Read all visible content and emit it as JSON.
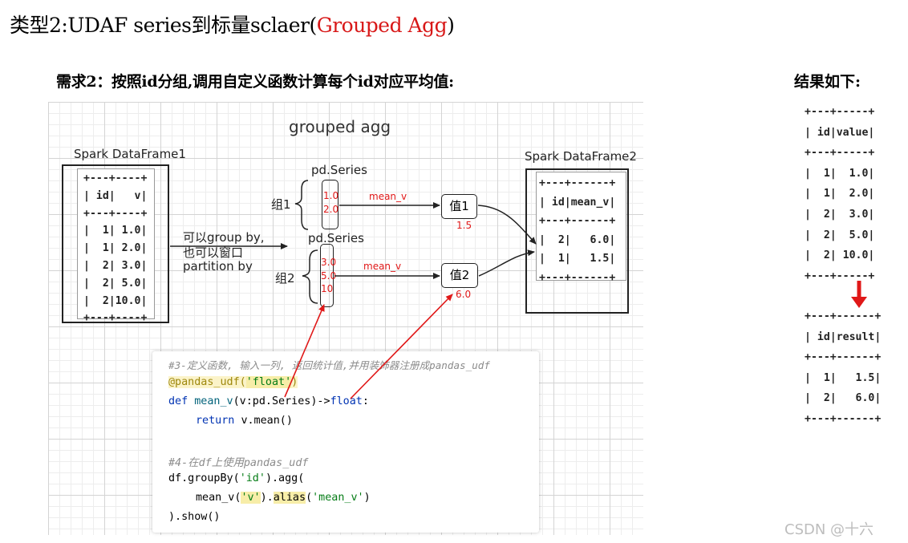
{
  "title": {
    "prefix": "类型2:UDAF series到标量sclaer(",
    "highlight": "Grouped Agg",
    "suffix": ")"
  },
  "requirement": "需求2：按照id分组,调用自定义函数计算每个id对应平均值:",
  "result_title": "结果如下:",
  "diagram": {
    "heading": "grouped agg",
    "df1": {
      "label": "Spark DataFrame1",
      "table": "+---+----+\n| id|   v|\n+---+----+\n|  1| 1.0|\n|  1| 2.0|\n|  2| 3.0|\n|  2| 5.0|\n|  2|10.0|\n+---+----+"
    },
    "df2": {
      "label": "Spark DataFrame2",
      "table": "+---+------+\n| id|mean_v|\n+---+------+\n|  2|   6.0|\n|  1|   1.5|\n+---+------+"
    },
    "series_label_1": "pd.Series",
    "series_label_2": "pd.Series",
    "group1_label": "组1",
    "group2_label": "组2",
    "group1_values": "1.0\n2.0",
    "group2_values": "3.0\n5.0\n10",
    "func_label_1": "mean_v",
    "func_label_2": "mean_v",
    "value1_label": "值1",
    "value2_label": "值2",
    "value1_result": "1.5",
    "value2_result": "6.0",
    "groupby_note_1": "可以group by,",
    "groupby_note_2": "也可以窗口",
    "groupby_note_3": "partition by"
  },
  "code": {
    "line1": "#3-定义函数, 输入一列, 返回统计值,并用装饰器注册成pandas_udf",
    "line2_deco": "@pandas_udf(",
    "line2_str": "'float'",
    "line2_end": ")",
    "line3_kw": "def ",
    "line3_fn": "mean_v",
    "line3_args": "(v:pd.Series)->",
    "line3_type": "float",
    "line3_end": ":",
    "line4_kw": "return ",
    "line4_rest": "v.mean()",
    "line6": "#4-在df上使用pandas_udf",
    "line7_a": "df.groupBy(",
    "line7_str": "'id'",
    "line7_b": ").agg(",
    "line8_a": "mean_v(",
    "line8_str": "'v'",
    "line8_b": ").",
    "line8_fn": "alias",
    "line8_c": "(",
    "line8_str2": "'mean_v'",
    "line8_d": ")",
    "line9": ").show()"
  },
  "results": {
    "table_before": "+---+-----+\n| id|value|\n+---+-----+\n|  1|  1.0|\n|  1|  2.0|\n|  2|  3.0|\n|  2|  5.0|\n|  2| 10.0|\n+---+-----+",
    "table_after": "+---+------+\n| id|result|\n+---+------+\n|  1|   1.5|\n|  2|   6.0|\n+---+------+"
  },
  "watermark": "CSDN @十六",
  "colors": {
    "highlight": "#d81818",
    "arrow": "#e01818"
  }
}
